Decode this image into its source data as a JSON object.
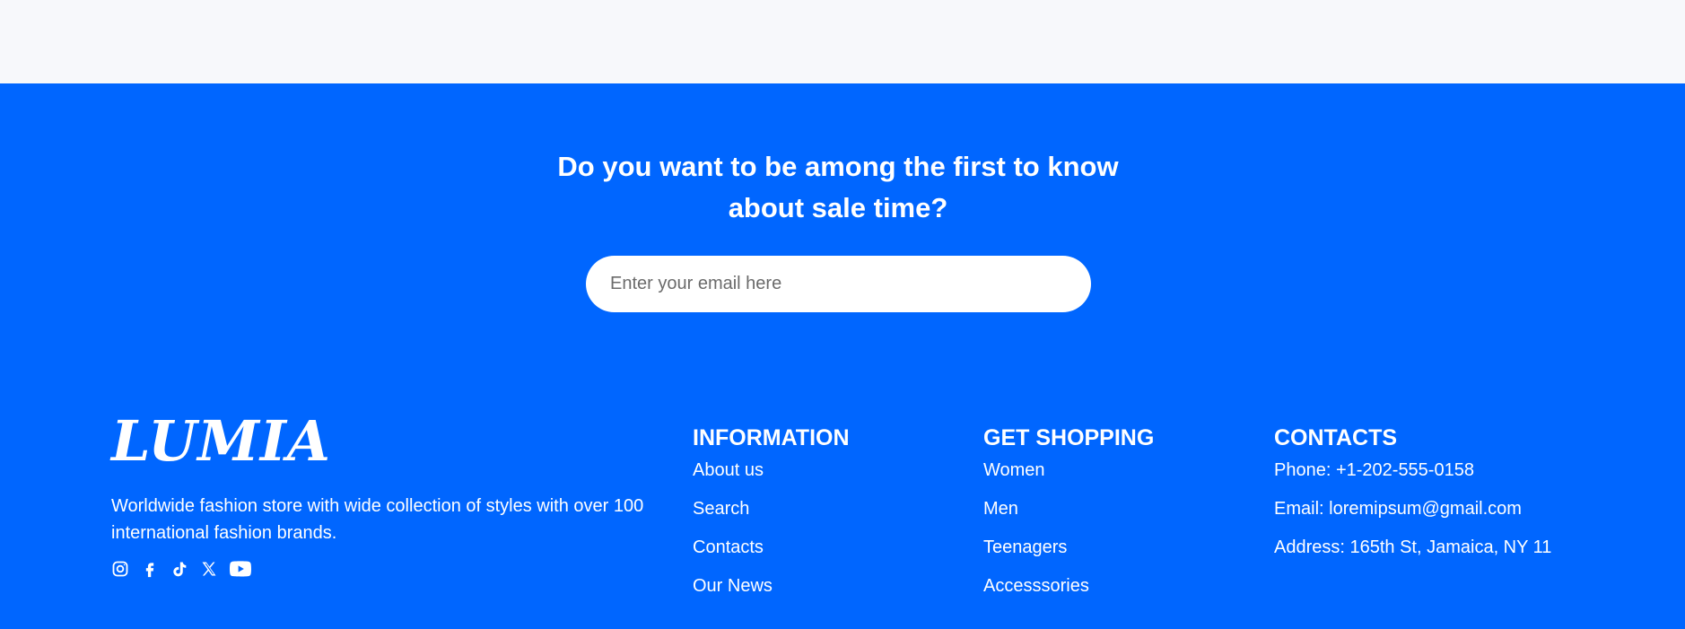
{
  "newsletter": {
    "title_line1": "Do you want to be among the first to know",
    "title_line2": "about sale time?",
    "email_placeholder": "Enter your email here"
  },
  "brand": {
    "logo_text": "LUMIA",
    "description": "Worldwide fashion store with wide collection of styles with over 100 international fashion brands."
  },
  "socials": [
    {
      "icon": "instagram-icon"
    },
    {
      "icon": "facebook-icon"
    },
    {
      "icon": "tiktok-icon"
    },
    {
      "icon": "x-icon"
    },
    {
      "icon": "youtube-icon"
    }
  ],
  "information": {
    "heading": "INFORMATION",
    "items": [
      "About us",
      "Search",
      "Contacts",
      "Our News"
    ]
  },
  "shopping": {
    "heading": "GET SHOPPING",
    "items": [
      "Women",
      "Men",
      "Teenagers",
      "Accesssories"
    ]
  },
  "contacts": {
    "heading": "CONTACTS",
    "phone": "Phone: +1-202-555-0158",
    "email": "Email: loremipsum@gmail.com",
    "address": "Address: 165th St, Jamaica, NY 11"
  },
  "colors": {
    "footer_bg": "#0066ff",
    "top_strip_bg": "#f7f8fb",
    "text": "#ffffff"
  }
}
